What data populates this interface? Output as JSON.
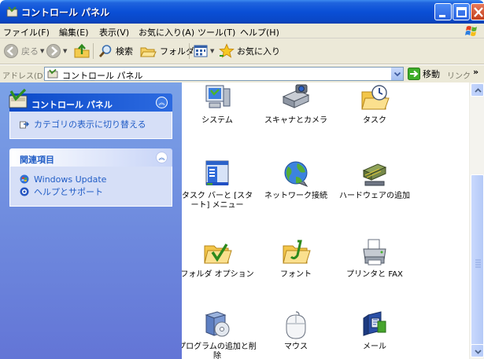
{
  "window": {
    "title": "コントロール パネル"
  },
  "menu": [
    "ファイル(F)",
    "編集(E)",
    "表示(V)",
    "お気に入り(A)",
    "ツール(T)",
    "ヘルプ(H)"
  ],
  "toolbar": {
    "back": "戻る",
    "search": "検索",
    "folders": "フォルダ",
    "favorites": "お気に入り"
  },
  "address": {
    "label": "アドレス(D)",
    "value": "コントロール パネル",
    "go": "移動",
    "links": "リンク"
  },
  "taskpane": {
    "panel1": {
      "title": "コントロール パネル",
      "links": [
        "カテゴリの表示に切り替える"
      ]
    },
    "panel2": {
      "title": "関連項目",
      "links": [
        "Windows Update",
        "ヘルプとサポート"
      ]
    }
  },
  "items": [
    {
      "label": "システム",
      "icon": "system-icon"
    },
    {
      "label": "スキャナとカメラ",
      "icon": "scanner-camera-icon"
    },
    {
      "label": "タスク",
      "icon": "scheduled-tasks-icon"
    },
    {
      "label": "タスク バーと [スタート] メニュー",
      "icon": "taskbar-start-menu-icon"
    },
    {
      "label": "ネットワーク接続",
      "icon": "network-connections-icon"
    },
    {
      "label": "ハードウェアの追加",
      "icon": "add-hardware-icon"
    },
    {
      "label": "フォルダ オプション",
      "icon": "folder-options-icon"
    },
    {
      "label": "フォント",
      "icon": "fonts-icon"
    },
    {
      "label": "プリンタと FAX",
      "icon": "printers-fax-icon"
    },
    {
      "label": "プログラムの追加と削除",
      "icon": "add-remove-programs-icon"
    },
    {
      "label": "マウス",
      "icon": "mouse-icon"
    },
    {
      "label": "メール",
      "icon": "mail-icon"
    }
  ],
  "colors": {
    "title_blue": "#0a4fd6",
    "taskpane_bg": "#7ba2e7",
    "link_blue": "#215dc6",
    "chrome": "#ece9d8"
  }
}
